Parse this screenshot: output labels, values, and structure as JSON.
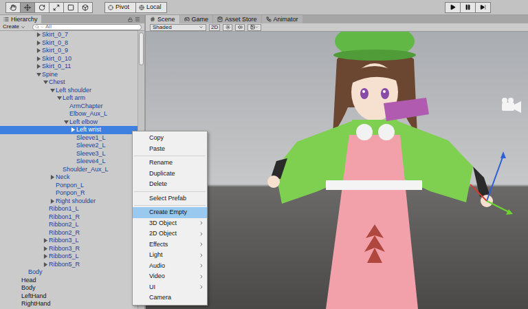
{
  "toolbar": {
    "tools": [
      {
        "selected": false
      },
      {
        "selected": true
      },
      {
        "selected": false
      },
      {
        "selected": false
      },
      {
        "selected": false
      },
      {
        "selected": false
      }
    ],
    "pivot": "Pivot",
    "space": "Local",
    "playback": [
      {
        "selected": false
      },
      {
        "selected": false
      },
      {
        "selected": false
      }
    ]
  },
  "hierarchy": {
    "tab": {
      "label": "Hierarchy",
      "selected": true
    },
    "create": "Create",
    "search": "All",
    "scrollbar": {
      "level": 0.12
    },
    "rows": [
      {
        "label": "Skirt_0_7",
        "depth": 3,
        "kind": "parent",
        "expanded": false,
        "prefab": true,
        "selected": false
      },
      {
        "label": "Skirt_0_8",
        "depth": 3,
        "kind": "parent",
        "expanded": false,
        "prefab": true,
        "selected": false
      },
      {
        "label": "Skirt_0_9",
        "depth": 3,
        "kind": "parent",
        "expanded": false,
        "prefab": true,
        "selected": false
      },
      {
        "label": "Skirt_0_10",
        "depth": 3,
        "kind": "parent",
        "expanded": false,
        "prefab": true,
        "selected": false
      },
      {
        "label": "Skirt_0_11",
        "depth": 3,
        "kind": "parent",
        "expanded": false,
        "prefab": true,
        "selected": false
      },
      {
        "label": "Spine",
        "depth": 3,
        "kind": "parent",
        "expanded": true,
        "prefab": true,
        "selected": false
      },
      {
        "label": "Chest",
        "depth": 4,
        "kind": "parent",
        "expanded": true,
        "prefab": true,
        "selected": false
      },
      {
        "label": "Left shoulder",
        "depth": 5,
        "kind": "parent",
        "expanded": true,
        "prefab": true,
        "selected": false
      },
      {
        "label": "Left arm",
        "depth": 6,
        "kind": "parent",
        "expanded": true,
        "prefab": true,
        "selected": false
      },
      {
        "label": "ArmChapter",
        "depth": 7,
        "kind": "leaf",
        "expanded": false,
        "prefab": true,
        "selected": false
      },
      {
        "label": "Elbow_Aux_L",
        "depth": 7,
        "kind": "leaf",
        "expanded": false,
        "prefab": true,
        "selected": false
      },
      {
        "label": "Left elbow",
        "depth": 7,
        "kind": "parent",
        "expanded": true,
        "prefab": true,
        "selected": false
      },
      {
        "label": "Left wrist",
        "depth": 8,
        "kind": "parent",
        "expanded": false,
        "prefab": true,
        "selected": true
      },
      {
        "label": "Sleeve1_L",
        "depth": 8,
        "kind": "leaf",
        "expanded": false,
        "prefab": true,
        "selected": false
      },
      {
        "label": "Sleeve2_L",
        "depth": 8,
        "kind": "leaf",
        "expanded": false,
        "prefab": true,
        "selected": false
      },
      {
        "label": "Sleeve3_L",
        "depth": 8,
        "kind": "leaf",
        "expanded": false,
        "prefab": true,
        "selected": false
      },
      {
        "label": "Sleeve4_L",
        "depth": 8,
        "kind": "leaf",
        "expanded": false,
        "prefab": true,
        "selected": false
      },
      {
        "label": "Shoulder_Aux_L",
        "depth": 6,
        "kind": "leaf",
        "expanded": false,
        "prefab": true,
        "selected": false
      },
      {
        "label": "Neck",
        "depth": 5,
        "kind": "parent",
        "expanded": false,
        "prefab": true,
        "selected": false
      },
      {
        "label": "Ponpon_L",
        "depth": 5,
        "kind": "leaf",
        "expanded": false,
        "prefab": true,
        "selected": false
      },
      {
        "label": "Ponpon_R",
        "depth": 5,
        "kind": "leaf",
        "expanded": false,
        "prefab": true,
        "selected": false
      },
      {
        "label": "Right shoulder",
        "depth": 5,
        "kind": "parent",
        "expanded": false,
        "prefab": true,
        "selected": false
      },
      {
        "label": "Ribbon1_L",
        "depth": 4,
        "kind": "leaf",
        "expanded": false,
        "prefab": true,
        "selected": false
      },
      {
        "label": "Ribbon1_R",
        "depth": 4,
        "kind": "leaf",
        "expanded": false,
        "prefab": true,
        "selected": false
      },
      {
        "label": "Ribbon2_L",
        "depth": 4,
        "kind": "leaf",
        "expanded": false,
        "prefab": true,
        "selected": false
      },
      {
        "label": "Ribbon2_R",
        "depth": 4,
        "kind": "leaf",
        "expanded": false,
        "prefab": true,
        "selected": false
      },
      {
        "label": "Ribbon3_L",
        "depth": 4,
        "kind": "parent",
        "expanded": false,
        "prefab": true,
        "selected": false
      },
      {
        "label": "Ribbon3_R",
        "depth": 4,
        "kind": "parent",
        "expanded": false,
        "prefab": true,
        "selected": false
      },
      {
        "label": "Ribbon5_L",
        "depth": 4,
        "kind": "parent",
        "expanded": false,
        "prefab": true,
        "selected": false
      },
      {
        "label": "Ribbon5_R",
        "depth": 4,
        "kind": "parent",
        "expanded": false,
        "prefab": true,
        "selected": false
      },
      {
        "label": "Body",
        "depth": 1,
        "kind": "leaf",
        "expanded": false,
        "prefab": true,
        "selected": false
      },
      {
        "label": "Head",
        "depth": 0,
        "kind": "leaf",
        "expanded": false,
        "prefab": false,
        "selected": false
      },
      {
        "label": "Body",
        "depth": 0,
        "kind": "leaf",
        "expanded": false,
        "prefab": false,
        "selected": false
      },
      {
        "label": "LeftHand",
        "depth": 0,
        "kind": "leaf",
        "expanded": false,
        "prefab": false,
        "selected": false
      },
      {
        "label": "RightHand",
        "depth": 0,
        "kind": "leaf",
        "expanded": false,
        "prefab": false,
        "selected": false
      }
    ]
  },
  "scene": {
    "tabs": [
      {
        "label": "Scene",
        "selected": true
      },
      {
        "label": "Game",
        "selected": false
      },
      {
        "label": "Asset Store",
        "selected": false
      },
      {
        "label": "Animator",
        "selected": false
      }
    ],
    "shading": "Shaded",
    "mode_2d": {
      "label": "2D",
      "selected": false
    }
  },
  "context_menu": {
    "groups": [
      [
        {
          "label": "Copy",
          "submenu": false,
          "selected": false
        },
        {
          "label": "Paste",
          "submenu": false,
          "selected": false
        }
      ],
      [
        {
          "label": "Rename",
          "submenu": false,
          "selected": false
        },
        {
          "label": "Duplicate",
          "submenu": false,
          "selected": false
        },
        {
          "label": "Delete",
          "submenu": false,
          "selected": false
        }
      ],
      [
        {
          "label": "Select Prefab",
          "submenu": false,
          "selected": false
        }
      ],
      [
        {
          "label": "Create Empty",
          "submenu": false,
          "selected": true
        },
        {
          "label": "3D Object",
          "submenu": true,
          "selected": false
        },
        {
          "label": "2D Object",
          "submenu": true,
          "selected": false
        },
        {
          "label": "Effects",
          "submenu": true,
          "selected": false
        },
        {
          "label": "Light",
          "submenu": true,
          "selected": false
        },
        {
          "label": "Audio",
          "submenu": true,
          "selected": false
        },
        {
          "label": "Video",
          "submenu": true,
          "selected": false
        },
        {
          "label": "UI",
          "submenu": true,
          "selected": false
        },
        {
          "label": "Camera",
          "submenu": false,
          "selected": false
        }
      ]
    ]
  }
}
